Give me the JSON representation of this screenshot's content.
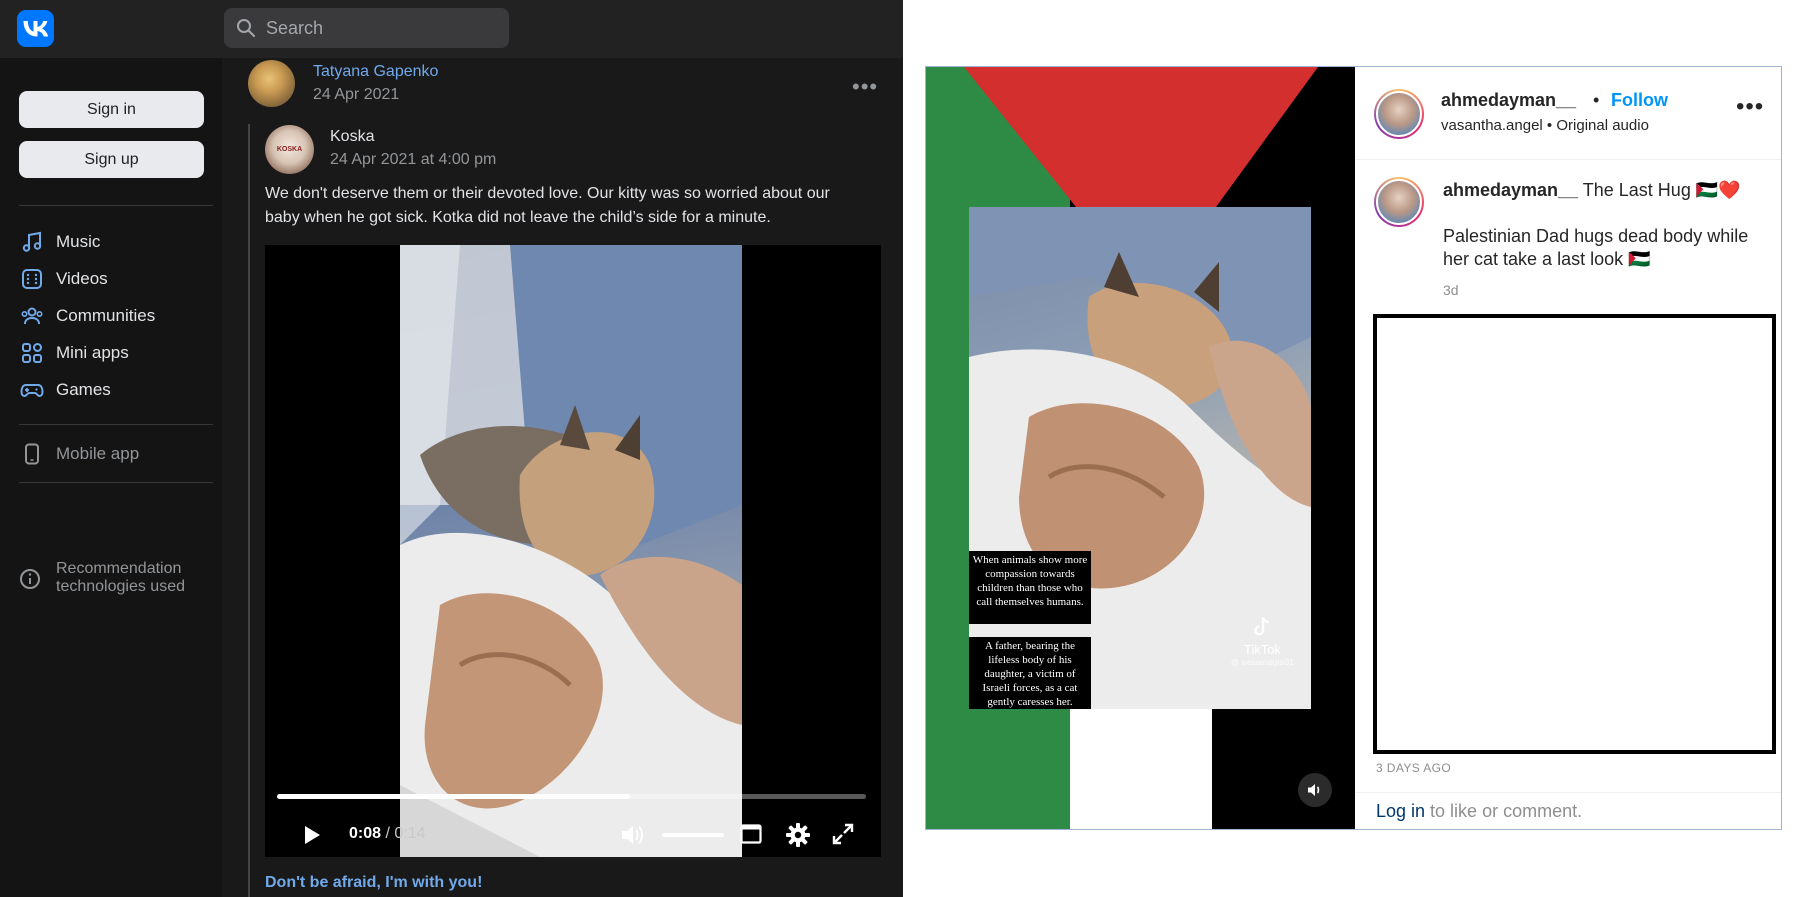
{
  "vk": {
    "search": {
      "placeholder": "Search"
    },
    "auth": {
      "sign_in": "Sign in",
      "sign_up": "Sign up"
    },
    "nav": [
      {
        "label": "Music",
        "icon": "music-icon"
      },
      {
        "label": "Videos",
        "icon": "videos-icon"
      },
      {
        "label": "Communities",
        "icon": "communities-icon"
      },
      {
        "label": "Mini apps",
        "icon": "mini-apps-icon"
      },
      {
        "label": "Games",
        "icon": "gamepad-icon"
      }
    ],
    "mobile_app": "Mobile app",
    "recommendation": {
      "line1": "Recommendation",
      "line2": "technologies used"
    },
    "post": {
      "author": "Tatyana Gapenko",
      "date": "24 Apr 2021",
      "repost": {
        "author": "Koska",
        "avatar_label": "KOSKA",
        "date": "24 Apr 2021 at 4:00 pm",
        "text": "We don't deserve them or their devoted love. Our kitty was so worried about our baby when he got sick. Kotka did not leave the child’s side for a minute.",
        "video": {
          "current_time": "0:08",
          "separator": " / ",
          "duration": "0:14",
          "progress": 0.6
        },
        "link_text": "Don't be afraid, I'm with you!"
      }
    },
    "colors": {
      "bg": "#19191a",
      "accent": "#71aaeb",
      "logo": "#0077ff"
    }
  },
  "instagram": {
    "username": "ahmedayman__",
    "separator": "•",
    "follow": "Follow",
    "audio_user": "vasantha.angel",
    "audio_label": "Original audio",
    "caption": {
      "username": "ahmedayman__",
      "title": "The Last Hug 🇵🇸❤️",
      "body": "Palestinian Dad hugs dead body while her cat take a last look 🇵🇸",
      "age": "3d"
    },
    "video_overlay": {
      "caption1": "When animals show more compassion towards children than those who call themselves humans.",
      "caption2": "A father, bearing the lifeless body of his daughter, a victim of Israeli forces, as a cat gently caresses her.",
      "tiktok": "TikTok",
      "tiktok_handle": "@ wesamalgisi31"
    },
    "timestamp": "3 DAYS AGO",
    "login_link": "Log in",
    "login_rest": " to like or comment.",
    "colors": {
      "follow": "#0095f6",
      "flag_red": "#d32f2f",
      "flag_green": "#2e8b45"
    }
  }
}
